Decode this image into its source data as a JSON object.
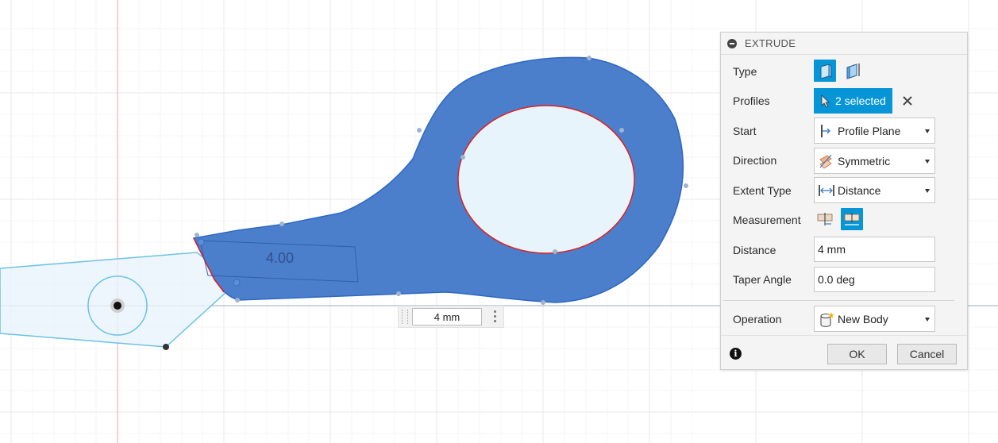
{
  "canvas": {
    "sketch_dimension": "4.00",
    "inline_distance_value": "4 mm"
  },
  "panel": {
    "title": "EXTRUDE",
    "rows": {
      "type": "Type",
      "profiles": "Profiles",
      "start": "Start",
      "direction": "Direction",
      "extent_type": "Extent Type",
      "measurement": "Measurement",
      "distance": "Distance",
      "taper_angle": "Taper Angle",
      "operation": "Operation"
    },
    "profiles_selected": "2 selected",
    "start_value": "Profile Plane",
    "direction_value": "Symmetric",
    "extent_type_value": "Distance",
    "distance_value": "4 mm",
    "taper_angle_value": "0.0 deg",
    "operation_value": "New Body",
    "ok_label": "OK",
    "cancel_label": "Cancel"
  },
  "colors": {
    "accent": "#0696d7",
    "body_fill": "#4b7fcc",
    "body_stroke": "#2e67c4",
    "sketch_fill": "#e8f4fb",
    "sketch_line": "#6cc2e6",
    "selection_edge": "#e02020",
    "origin_axis": "#f0a0a0"
  },
  "icons": {
    "collapse": "collapse-icon",
    "type_solid": "solid-extrude-icon",
    "type_thin": "thin-extrude-icon",
    "profiles": "select-cursor-icon",
    "clear": "clear-selection-icon",
    "start": "profile-plane-icon",
    "direction": "symmetric-icon",
    "extent": "distance-extent-icon",
    "measurement_half": "half-length-icon",
    "measurement_whole": "whole-length-icon",
    "operation": "new-body-icon",
    "info": "info-icon"
  }
}
